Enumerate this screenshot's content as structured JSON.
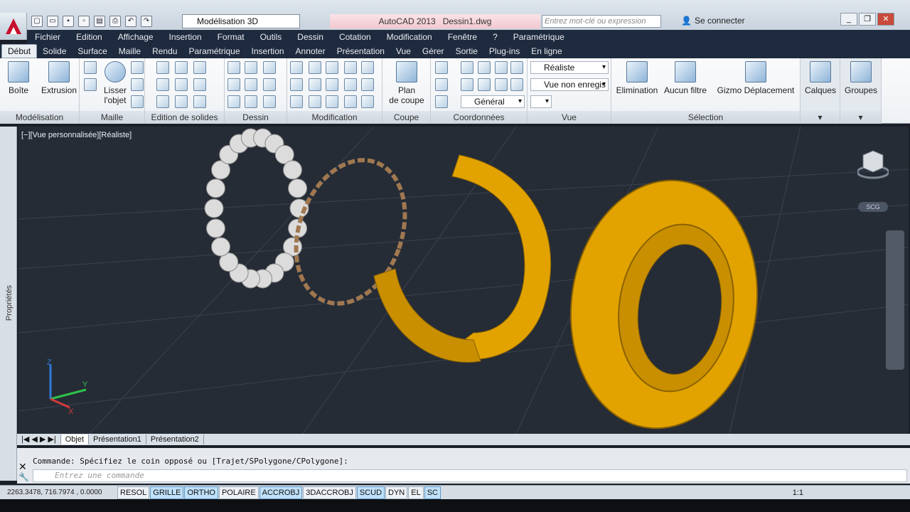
{
  "app": {
    "title": "AutoCAD 2013",
    "document": "Dessin1.dwg"
  },
  "workspace": "Modélisation 3D",
  "search_placeholder": "Entrez mot-clé ou expression",
  "signin_label": "Se connecter",
  "menu": [
    "Fichier",
    "Edition",
    "Affichage",
    "Insertion",
    "Format",
    "Outils",
    "Dessin",
    "Cotation",
    "Modification",
    "Fenêtre",
    "?",
    "Paramétrique"
  ],
  "tabs": [
    "Début",
    "Solide",
    "Surface",
    "Maille",
    "Rendu",
    "Paramétrique",
    "Insertion",
    "Annoter",
    "Présentation",
    "Vue",
    "Gérer",
    "Sortie",
    "Plug-ins",
    "En ligne"
  ],
  "ribbon": {
    "modelisation": {
      "title": "Modélisation",
      "box": "Boîte",
      "extrusion": "Extrusion"
    },
    "maille": {
      "title": "Maille",
      "lisser": "Lisser\nl'objet"
    },
    "solides": {
      "title": "Edition de solides"
    },
    "dessin": {
      "title": "Dessin"
    },
    "modification": {
      "title": "Modification"
    },
    "coupe": {
      "title": "Coupe",
      "plan": "Plan\nde coupe"
    },
    "coordonnees": {
      "title": "Coordonnées",
      "general": "Général"
    },
    "vue": {
      "title": "Vue",
      "style": "Réaliste",
      "view": "Vue non enregis"
    },
    "selection": {
      "title": "Sélection",
      "elimination": "Elimination",
      "aucun": "Aucun filtre",
      "gizmo": "Gizmo Déplacement"
    },
    "calques": "Calques",
    "groupes": "Groupes"
  },
  "viewport": {
    "label": "[−][Vue personnalisée][Réaliste]",
    "wcs": "SCG",
    "axes": {
      "x": "X",
      "y": "Y",
      "z": "Z"
    }
  },
  "properties_label": "Propriétés",
  "layout_tabs": [
    "Objet",
    "Présentation1",
    "Présentation2"
  ],
  "command": {
    "history": "Commande: Spécifiez le coin opposé ou [Trajet/SPolygone/CPolygone]:",
    "placeholder": "Entrez une commande"
  },
  "status": {
    "coords": "2263.3478, 716.7974 , 0.0000",
    "buttons": [
      {
        "label": "RESOL",
        "on": false
      },
      {
        "label": "GRILLE",
        "on": true
      },
      {
        "label": "ORTHO",
        "on": true
      },
      {
        "label": "POLAIRE",
        "on": false
      },
      {
        "label": "ACCROBJ",
        "on": true
      },
      {
        "label": "3DACCROBJ",
        "on": false
      },
      {
        "label": "SCUD",
        "on": true
      },
      {
        "label": "DYN",
        "on": false
      },
      {
        "label": "EL",
        "on": false
      },
      {
        "label": "SC",
        "on": true
      }
    ],
    "scale": "1:1"
  },
  "colors": {
    "bearing": "#e2a300",
    "ball": "#dcdcdc",
    "cage": "#a07850",
    "grid": "#3a4250"
  }
}
